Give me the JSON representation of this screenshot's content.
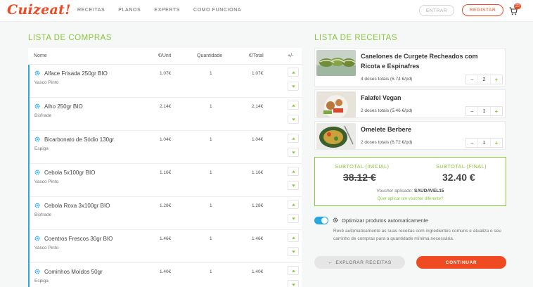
{
  "brand": {
    "logo_text": "Cuizeat!",
    "accent": "#ef4a23",
    "green": "#8cc63f",
    "blue": "#29a8e0"
  },
  "nav": {
    "items": [
      "RECEITAS",
      "PLANOS",
      "EXPERTS",
      "COMO FUNCIONA"
    ]
  },
  "auth": {
    "login_label": "ENTRAR",
    "register_label": "REGISTAR"
  },
  "cart": {
    "icon": "cart-icon",
    "count": "22"
  },
  "shopping_list": {
    "title": "LISTA DE COMPRAS",
    "columns": {
      "name": "Nome",
      "unit": "€/Unit",
      "qty": "Quantidade",
      "total": "€/Total",
      "plusminus": "+/-"
    },
    "rows": [
      {
        "name": "Alface Frisada 250gr BIO",
        "supplier": "Vasco Pinto",
        "unit": "1.07€",
        "qty": "1",
        "total": "1.07€"
      },
      {
        "name": "Alho 250gr BIO",
        "supplier": "Biofrade",
        "unit": "2.14€",
        "qty": "1",
        "total": "2.14€"
      },
      {
        "name": "Bicarbonato de Sódio 130gr",
        "supplier": "Espiga",
        "unit": "1.04€",
        "qty": "1",
        "total": "1.04€"
      },
      {
        "name": "Cebola 5x100gr BIO",
        "supplier": "Vasco Pinto",
        "unit": "1.16€",
        "qty": "1",
        "total": "1.16€"
      },
      {
        "name": "Cebola Roxa 3x100gr BIO",
        "supplier": "Biofrade",
        "unit": "1.28€",
        "qty": "1",
        "total": "1.28€"
      },
      {
        "name": "Coentros Frescos 30gr BIO",
        "supplier": "Vasco Pinto",
        "unit": "1.46€",
        "qty": "1",
        "total": "1.46€"
      },
      {
        "name": "Cominhos Moídos 50gr",
        "supplier": "Espiga",
        "unit": "1.40€",
        "qty": "1",
        "total": "1.40€"
      }
    ]
  },
  "recipes": {
    "title": "LISTA DE RECEITAS",
    "items": [
      {
        "name": "Canelones de Curgete Recheados com Ricota e Espinafres",
        "doses": "4 doses totais (6.74 €/pd)",
        "count": "2"
      },
      {
        "name": "Falafel Vegan",
        "doses": "2 doses totais (5.46 €/pd)",
        "count": "1"
      },
      {
        "name": "Omelete Berbere",
        "doses": "2 doses totais (6.72 €/pd)",
        "count": "1"
      }
    ]
  },
  "totals": {
    "initial_label": "SUBTOTAL (INICIAL)",
    "final_label": "SUBTOTAL (FINAL)",
    "initial_value": "38.12 €",
    "final_value": "32.40 €",
    "voucher_prefix": "Voucher aplicado:",
    "voucher_code": "SAUDAVEL15",
    "voucher_link": "Quer aplicar um voucher diferente?"
  },
  "optimize": {
    "enabled": true,
    "label": "Optimizar produtos automaticamente",
    "description": "Revê automaticamente as suas receitas com ingredientes comuns e atualiza o seu carrinho de compras para a quantidade mínima necessária."
  },
  "actions": {
    "explore_label": "EXPLORAR RECEITAS",
    "continue_label": "CONTINUAR"
  }
}
